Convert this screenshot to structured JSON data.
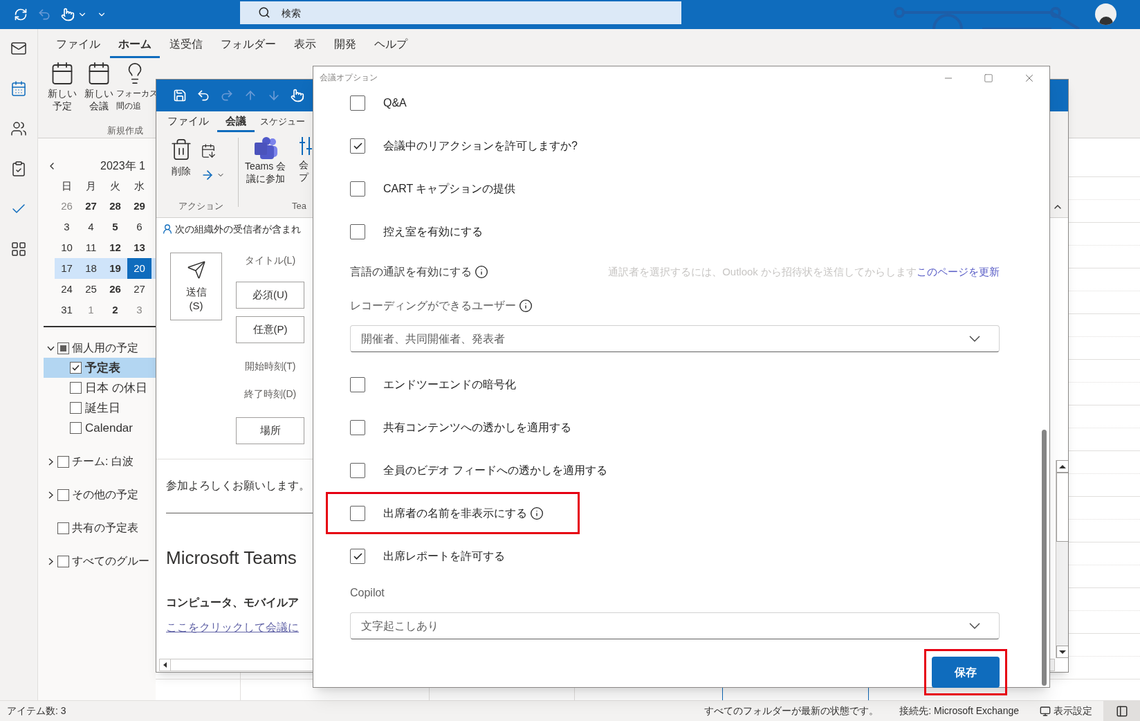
{
  "title_bar": {
    "search": {
      "placeholder": "検索"
    }
  },
  "navigation": [
    {
      "selected": false
    },
    {
      "selected": true
    },
    {
      "selected": false
    },
    {
      "selected": false
    },
    {
      "selected": false
    },
    {
      "selected": false
    }
  ],
  "ribbon": {
    "tabs": [
      {
        "label": "ファイル",
        "selected": false
      },
      {
        "label": "ホーム",
        "selected": true
      },
      {
        "label": "送受信",
        "selected": false
      },
      {
        "label": "フォルダー",
        "selected": false
      },
      {
        "label": "表示",
        "selected": false
      },
      {
        "label": "開発",
        "selected": false
      },
      {
        "label": "ヘルプ",
        "selected": false
      }
    ],
    "buttons": [
      {
        "lines": [
          "新しい",
          "予定"
        ]
      },
      {
        "lines": [
          "新しい",
          "会議"
        ]
      },
      {
        "lines": [
          "フォーカス",
          "間の追"
        ]
      }
    ],
    "group_label": "新規作成"
  },
  "date_picker": {
    "month": "2023年 1",
    "weekdays": [
      "日",
      "月",
      "火",
      "水"
    ],
    "weeks": [
      {
        "highlighted": false,
        "days": [
          {
            "day": "26",
            "bold": false,
            "muted": true,
            "selected": false
          },
          {
            "day": "27",
            "bold": true,
            "muted": false,
            "selected": false
          },
          {
            "day": "28",
            "bold": true,
            "muted": false,
            "selected": false
          },
          {
            "day": "29",
            "bold": true,
            "muted": false,
            "selected": false
          }
        ]
      },
      {
        "highlighted": false,
        "days": [
          {
            "day": "3",
            "bold": false,
            "muted": false,
            "selected": false
          },
          {
            "day": "4",
            "bold": false,
            "muted": false,
            "selected": false
          },
          {
            "day": "5",
            "bold": true,
            "muted": false,
            "selected": false
          },
          {
            "day": "6",
            "bold": false,
            "muted": false,
            "selected": false
          }
        ]
      },
      {
        "highlighted": false,
        "days": [
          {
            "day": "10",
            "bold": false,
            "muted": false,
            "selected": false
          },
          {
            "day": "11",
            "bold": false,
            "muted": false,
            "selected": false
          },
          {
            "day": "12",
            "bold": true,
            "muted": false,
            "selected": false
          },
          {
            "day": "13",
            "bold": true,
            "muted": false,
            "selected": false
          }
        ]
      },
      {
        "highlighted": true,
        "days": [
          {
            "day": "17",
            "bold": false,
            "muted": false,
            "selected": false
          },
          {
            "day": "18",
            "bold": false,
            "muted": false,
            "selected": false
          },
          {
            "day": "19",
            "bold": true,
            "muted": false,
            "selected": false
          },
          {
            "day": "20",
            "bold": false,
            "muted": false,
            "selected": true
          }
        ]
      },
      {
        "highlighted": false,
        "days": [
          {
            "day": "24",
            "bold": false,
            "muted": false,
            "selected": false
          },
          {
            "day": "25",
            "bold": false,
            "muted": false,
            "selected": false
          },
          {
            "day": "26",
            "bold": true,
            "muted": false,
            "selected": false
          },
          {
            "day": "27",
            "bold": false,
            "muted": false,
            "selected": false
          }
        ]
      },
      {
        "highlighted": false,
        "days": [
          {
            "day": "31",
            "bold": false,
            "muted": false,
            "selected": false
          },
          {
            "day": "1",
            "bold": false,
            "muted": true,
            "selected": false
          },
          {
            "day": "2",
            "bold": true,
            "muted": false,
            "selected": false
          },
          {
            "day": "3",
            "bold": false,
            "muted": true,
            "selected": false
          }
        ]
      }
    ]
  },
  "folders": [
    {
      "label": "個人用の予定",
      "kind": "expandable",
      "expanded": true,
      "checked": false,
      "partial": true,
      "children": [
        {
          "label": "予定表",
          "checked": true,
          "selected": true
        },
        {
          "label": "日本 の休日",
          "checked": false,
          "selected": false
        },
        {
          "label": "誕生日",
          "checked": false,
          "selected": false
        },
        {
          "label": "Calendar",
          "checked": false,
          "selected": false
        }
      ]
    },
    {
      "label": "チーム: 白波",
      "kind": "expandable",
      "expanded": false,
      "checked": false,
      "partial": false
    },
    {
      "label": "その他の予定",
      "kind": "expandable",
      "expanded": false,
      "checked": false,
      "partial": false
    },
    {
      "label": "共有の予定表",
      "kind": "plain",
      "checked": false,
      "partial": false
    },
    {
      "label": "すべてのグルー",
      "kind": "expandable",
      "expanded": false,
      "checked": false,
      "partial": false
    }
  ],
  "meeting_window": {
    "tabs": [
      {
        "label": "ファイル",
        "selected": false
      },
      {
        "label": "会議",
        "selected": true
      },
      {
        "label": "スケジュー",
        "selected": false
      }
    ],
    "ribbon_buttons": [
      {
        "lines": [
          "削除"
        ]
      },
      {
        "lines": [
          "Teams 会",
          "議に参加"
        ]
      },
      {
        "lines": [
          "会",
          "プ"
        ]
      }
    ],
    "groups": [
      "アクション",
      "Tea"
    ],
    "info_bar": "次の組織外の受信者が含まれ",
    "send_button": [
      "送信",
      "(S)"
    ],
    "fields": [
      {
        "kind": "label",
        "text": "タイトル(L)"
      },
      {
        "kind": "button",
        "text": "必須(U)"
      },
      {
        "kind": "button",
        "text": "任意(P)"
      },
      {
        "kind": "label",
        "text": "開始時刻(T)"
      },
      {
        "kind": "label",
        "text": "終了時刻(D)"
      },
      {
        "kind": "button",
        "text": "場所"
      }
    ],
    "body": {
      "greeting": "参加よろしくお願いします。",
      "heading": "Microsoft Teams",
      "subheading": "コンピュータ、モバイルア",
      "link": "ここをクリックして会議に"
    }
  },
  "dialog": {
    "title": "会議オプション",
    "settings": [
      {
        "kind": "checkbox",
        "label": "Q&A",
        "checked": false,
        "info": false,
        "highlighted": false
      },
      {
        "kind": "checkbox",
        "label": "会議中のリアクションを許可しますか?",
        "checked": true,
        "info": false,
        "highlighted": false
      },
      {
        "kind": "checkbox",
        "label": "CART キャプションの提供",
        "checked": false,
        "info": false,
        "highlighted": false
      },
      {
        "kind": "checkbox",
        "label": "控え室を有効にする",
        "checked": false,
        "info": false,
        "highlighted": false
      },
      {
        "kind": "notice",
        "label": "言語の通訳を有効にする",
        "info": true,
        "note": "通訳者を選択するには、Outlook から招待状を送信してからします",
        "link": "このページを更新"
      },
      {
        "kind": "select",
        "label": "レコーディングができるユーザー",
        "info": true,
        "value": "開催者、共同開催者、発表者"
      },
      {
        "kind": "checkbox",
        "label": "エンドツーエンドの暗号化",
        "checked": false,
        "info": false,
        "highlighted": false
      },
      {
        "kind": "checkbox",
        "label": "共有コンテンツへの透かしを適用する",
        "checked": false,
        "info": false,
        "highlighted": false
      },
      {
        "kind": "checkbox",
        "label": "全員のビデオ フィードへの透かしを適用する",
        "checked": false,
        "info": false,
        "highlighted": false
      },
      {
        "kind": "checkbox",
        "label": "出席者の名前を非表示にする",
        "checked": false,
        "info": true,
        "highlighted": true
      },
      {
        "kind": "checkbox",
        "label": "出席レポートを許可する",
        "checked": true,
        "info": false,
        "highlighted": false
      },
      {
        "kind": "select",
        "label": "Copilot",
        "info": false,
        "value": "文字起こしあり"
      }
    ],
    "save_button": {
      "label": "保存",
      "highlighted": true
    }
  },
  "status_bar": {
    "item_count": "アイテム数: 3",
    "sync_status": "すべてのフォルダーが最新の状態です。",
    "connection": "接続先: Microsoft Exchange",
    "view_settings": "表示設定"
  }
}
